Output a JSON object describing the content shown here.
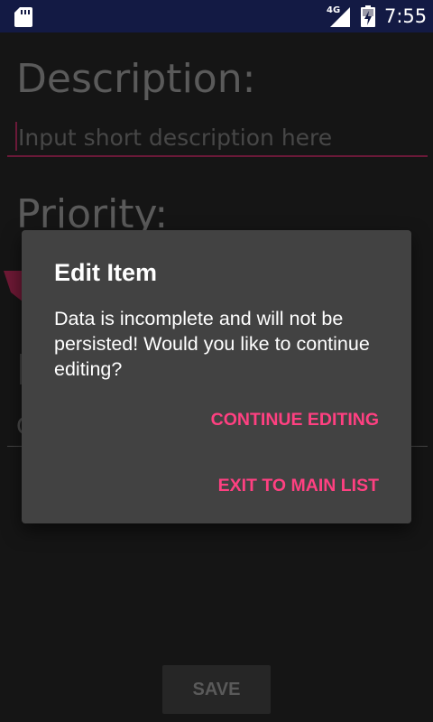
{
  "status_bar": {
    "network_type": "4G",
    "time": "7:55",
    "icons": [
      "sd-card-icon",
      "cell-signal-icon",
      "battery-charging-icon"
    ]
  },
  "form": {
    "description_label": "Description:",
    "description_placeholder": "Input short description here",
    "description_value": "",
    "priority_label": "Priority:",
    "save_label": "SAVE"
  },
  "dialog": {
    "title": "Edit Item",
    "message": "Data is incomplete and will not be persisted! Would you like to continue editing?",
    "continue_label": "CONTINUE EDITING",
    "exit_label": "EXIT TO MAIN LIST"
  },
  "colors": {
    "status_bar": "#131a44",
    "background": "#151515",
    "dialog": "#424242",
    "accent": "#ff4081",
    "input_underline": "#6a1938"
  }
}
